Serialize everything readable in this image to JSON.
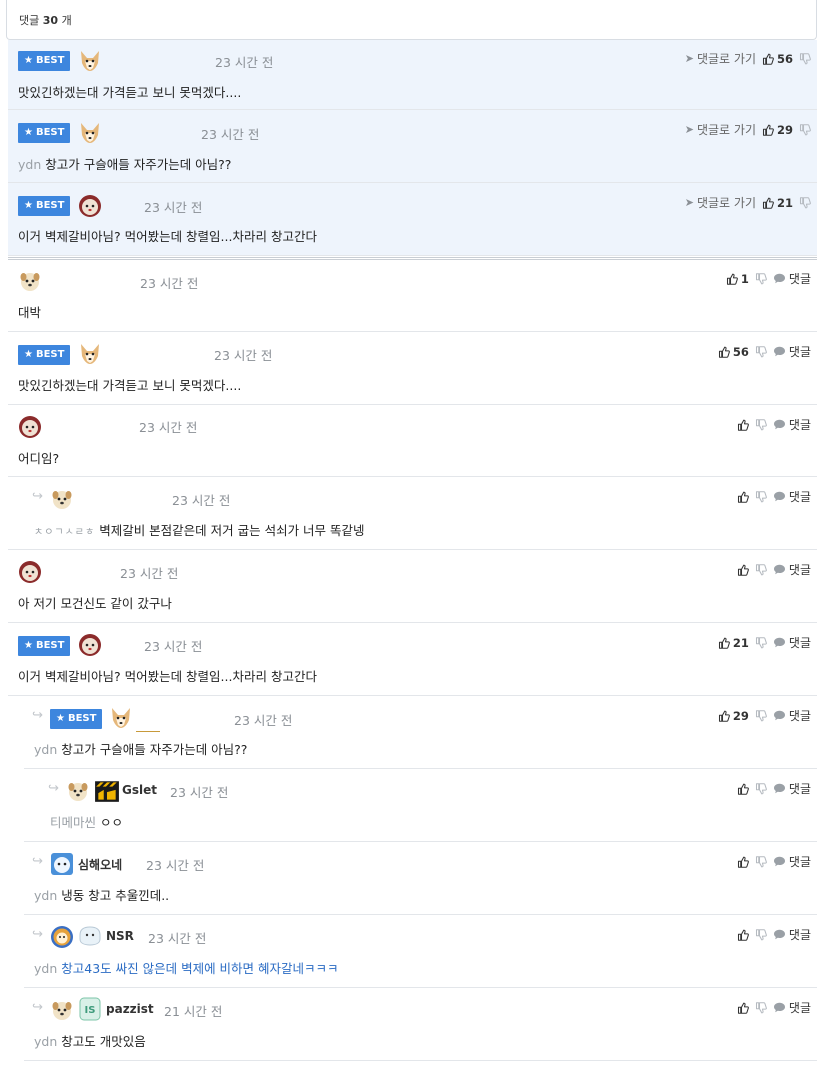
{
  "header": {
    "prefix": "댓글",
    "count": "30",
    "suffix": "개"
  },
  "labels": {
    "best": "BEST",
    "goto": "댓글로 가기",
    "reply": "댓글"
  },
  "colors": {
    "best_badge": "#3d86de",
    "best_row_bg": "#eef4fc",
    "link_text": "#2b6cc4"
  },
  "best_comments": [
    {
      "time": "23 시간 전",
      "prefix": "",
      "text": "맛있긴하겠는대 가격듣고 보니 못먹겠다....",
      "likes": "56"
    },
    {
      "time": "23 시간 전",
      "prefix": "ydn",
      "text": "창고가 구슬애들 자주가는데 아님??",
      "likes": "29"
    },
    {
      "time": "23 시간 전",
      "prefix": "",
      "text": "이거 벽제갈비아님? 먹어봤는데 창렬임...차라리 창고간다",
      "likes": "21"
    }
  ],
  "comments": [
    {
      "time": "23 시간 전",
      "text": "대박",
      "likes": "1"
    },
    {
      "time": "23 시간 전",
      "text": "맛있긴하겠는대 가격듣고 보니 못먹겠다....",
      "likes": "56"
    },
    {
      "time": "23 시간 전",
      "text": "어디임?",
      "likes": ""
    },
    {
      "time": "23 시간 전",
      "prefix": "ㅊㅇㄱㅅㄹㅎ",
      "text": "벽제갈비 본점같은데 저거 굽는 석쇠가 너무 똑같넹",
      "likes": ""
    },
    {
      "time": "23 시간 전",
      "text": "아 저기 모건신도 같이 갔구나",
      "likes": ""
    },
    {
      "time": "23 시간 전",
      "text": "이거 벽제갈비아님? 먹어봤는데 창렬임...차라리 창고간다",
      "likes": "21"
    },
    {
      "time": "23 시간 전",
      "prefix": "ydn",
      "text": "창고가 구슬애들 자주가는데 아님??",
      "likes": "29"
    },
    {
      "user": "Gslet",
      "time": "23 시간 전",
      "prefix": "티메마씬",
      "text": "ㅇㅇ",
      "likes": ""
    },
    {
      "user": "심해오네",
      "time": "23 시간 전",
      "prefix": "ydn",
      "text": "냉동 창고 추울낀데..",
      "likes": ""
    },
    {
      "user": "NSR",
      "time": "23 시간 전",
      "prefix": "ydn",
      "text": "창고43도 싸진 않은데 벽제에 비하면 혜자갈네ㅋㅋㅋ",
      "likes": ""
    },
    {
      "user": "pazzist",
      "time": "21 시간 전",
      "prefix": "ydn",
      "text": "창고도 개맛있음",
      "likes": ""
    }
  ]
}
